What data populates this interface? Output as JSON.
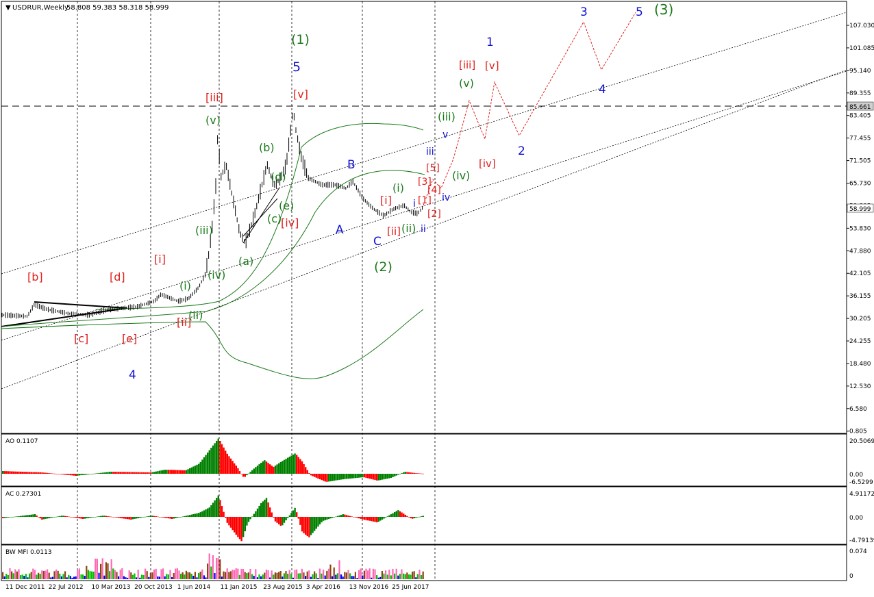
{
  "header": {
    "symbol_label": "USDRUR,Weekly",
    "ohlc": "58.808 59.383 58.318 58.999"
  },
  "colors": {
    "wave_red": "#e0201c",
    "wave_green": "#1a7a1a",
    "wave_blue": "#1010d0",
    "price_bar": "#000000",
    "ao_up": "#008000",
    "ao_down": "#ff0000",
    "mfi_blue": "#0000ff",
    "mfi_green": "#00c000",
    "mfi_brown": "#8b4513",
    "mfi_pink": "#ff69b4"
  },
  "price_axis": {
    "ticks": [
      "107.030",
      "101.085",
      "95.140",
      "89.355",
      "83.405",
      "77.455",
      "71.505",
      "65.730",
      "59.805",
      "53.830",
      "47.880",
      "42.105",
      "36.155",
      "30.205",
      "24.255",
      "18.480",
      "12.530",
      "6.580",
      "0.805"
    ],
    "current_price": "58.999",
    "level_price": "85.661"
  },
  "time_axis": {
    "labels": [
      "11 Dec 2011",
      "22 Jul 2012",
      "10 Mar 2013",
      "20 Oct 2013",
      "1 Jun 2014",
      "11 Jan 2015",
      "23 Aug 2015",
      "3 Apr 2016",
      "13 Nov 2016",
      "25 Jun 2017"
    ]
  },
  "wave_labels": [
    {
      "text": "[b]",
      "color": "red"
    },
    {
      "text": "[d]",
      "color": "red"
    },
    {
      "text": "[i]",
      "color": "red"
    },
    {
      "text": "[iii]",
      "color": "red"
    },
    {
      "text": "[v]",
      "color": "red"
    },
    {
      "text": "[c]",
      "color": "red"
    },
    {
      "text": "[e]",
      "color": "red"
    },
    {
      "text": "[ii]",
      "color": "red"
    },
    {
      "text": "[iv]",
      "color": "red"
    },
    {
      "text": "[i]",
      "color": "red"
    },
    {
      "text": "[ii]",
      "color": "red"
    },
    {
      "text": "[1]",
      "color": "red"
    },
    {
      "text": "[2]",
      "color": "red"
    },
    {
      "text": "[3]",
      "color": "red"
    },
    {
      "text": "[4]",
      "color": "red"
    },
    {
      "text": "[5]",
      "color": "red"
    },
    {
      "text": "[iii]",
      "color": "red"
    },
    {
      "text": "[v]",
      "color": "red"
    },
    {
      "text": "[iv]",
      "color": "red"
    },
    {
      "text": "(1)",
      "color": "green"
    },
    {
      "text": "(v)",
      "color": "green"
    },
    {
      "text": "(b)",
      "color": "green"
    },
    {
      "text": "(d)",
      "color": "green"
    },
    {
      "text": "(e)",
      "color": "green"
    },
    {
      "text": "(c)",
      "color": "green"
    },
    {
      "text": "(a)",
      "color": "green"
    },
    {
      "text": "(iii)",
      "color": "green"
    },
    {
      "text": "(iv)",
      "color": "green"
    },
    {
      "text": "(i)",
      "color": "green"
    },
    {
      "text": "(ii)",
      "color": "green"
    },
    {
      "text": "(i)",
      "color": "green"
    },
    {
      "text": "(ii)",
      "color": "green"
    },
    {
      "text": "(2)",
      "color": "green"
    },
    {
      "text": "(iii)",
      "color": "green"
    },
    {
      "text": "(v)",
      "color": "green"
    },
    {
      "text": "(iv)",
      "color": "green"
    },
    {
      "text": "(3)",
      "color": "green"
    },
    {
      "text": "5",
      "color": "blue"
    },
    {
      "text": "B",
      "color": "blue"
    },
    {
      "text": "A",
      "color": "blue"
    },
    {
      "text": "C",
      "color": "blue"
    },
    {
      "text": "4",
      "color": "blue"
    },
    {
      "text": "i",
      "color": "blue"
    },
    {
      "text": "ii",
      "color": "blue"
    },
    {
      "text": "iii",
      "color": "blue"
    },
    {
      "text": "iv",
      "color": "blue"
    },
    {
      "text": "v",
      "color": "blue"
    },
    {
      "text": "1",
      "color": "blue"
    },
    {
      "text": "2",
      "color": "blue"
    },
    {
      "text": "3",
      "color": "blue"
    },
    {
      "text": "4",
      "color": "blue"
    },
    {
      "text": "5",
      "color": "blue"
    }
  ],
  "indicators": {
    "ao": {
      "label": "AO 0.1107",
      "ticks": [
        "20.5069",
        "0.00",
        "-6.5299"
      ]
    },
    "ac": {
      "label": "AC 0.27301",
      "ticks": [
        "4.91172",
        "0.00",
        "-4.79139"
      ]
    },
    "mfi": {
      "label": "BW MFI 0.0113",
      "ticks": [
        "0.074",
        "0"
      ]
    }
  }
}
